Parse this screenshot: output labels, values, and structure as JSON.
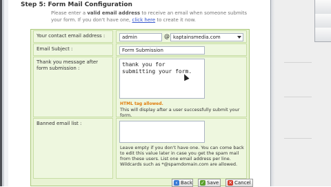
{
  "header": {
    "title": "Step 5: Form Mail Configuration",
    "intro_pre": "Please enter a ",
    "intro_bold": "valid email address",
    "intro_mid": " to receive an email when someone submits your form. If you don't have one, ",
    "intro_link": "click here",
    "intro_post": " to create it now."
  },
  "email": {
    "label": "Your contact email address :",
    "user": "admin",
    "at": "@",
    "domain": "kaptainsmedia.com"
  },
  "subject": {
    "label": "Email Subject :",
    "value": "Form Submission"
  },
  "thankyou": {
    "label": "Thank you message after form submission :",
    "value": "thank you for\nsubmitting your form.",
    "note_tag": "HTML tag allowed.",
    "note": "This will display after a user successfully submit your form."
  },
  "banned": {
    "label": "Banned email list :",
    "value": "",
    "note": "Leave empty if you don't have one. You can come back to edit this value later in case you get the spam mail from these users. List one email address per line. Wildcards such as *@spamdomain.com are allowed."
  },
  "buttons": {
    "back": "Back",
    "save": "Save",
    "cancel": "Cancel"
  },
  "colors": {
    "panel_bg": "#e8f3d3",
    "panel_border": "#a9c77a",
    "note_orange": "#e07b0a",
    "link": "#3355cc"
  }
}
